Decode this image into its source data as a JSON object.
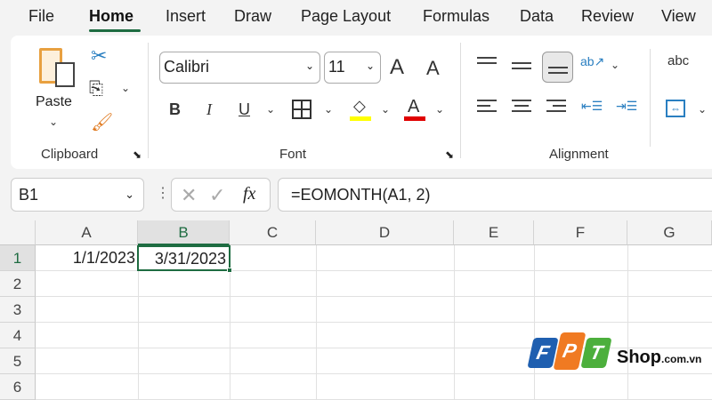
{
  "tabs": [
    "File",
    "Home",
    "Insert",
    "Draw",
    "Page Layout",
    "Formulas",
    "Data",
    "Review",
    "View"
  ],
  "ribbon": {
    "paste": "Paste",
    "font_name": "Calibri",
    "font_size": "11",
    "groups": {
      "clipboard": "Clipboard",
      "font": "Font",
      "alignment": "Alignment"
    },
    "bold": "B",
    "italic": "I",
    "underline": "U",
    "grow": "A",
    "shrink": "A",
    "font_color": "A",
    "wrap": "abc"
  },
  "formula_bar": {
    "name_box": "B1",
    "fx": "fx",
    "formula": "=EOMONTH(A1, 2)"
  },
  "columns": [
    "A",
    "B",
    "C",
    "D",
    "E",
    "F",
    "G"
  ],
  "rows": [
    "1",
    "2",
    "3",
    "4",
    "5",
    "6"
  ],
  "cells": {
    "A1": "1/1/2023",
    "B1": "3/31/2023"
  },
  "watermark": {
    "logo": "FPT",
    "text": "Shop",
    "suffix": ".com.vn"
  },
  "colors": {
    "accent": "#1e6c41",
    "highlight": "#ffff00",
    "font_color": "#e00000"
  }
}
